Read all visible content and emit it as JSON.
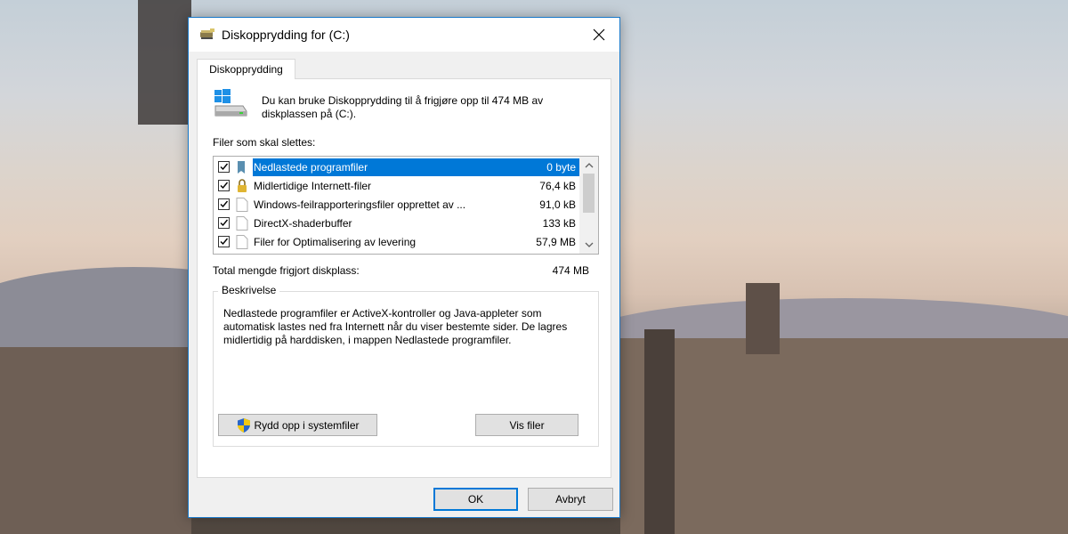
{
  "window": {
    "title": "Diskopprydding for  (C:)",
    "close_glyph": "✕"
  },
  "tab": {
    "label": "Diskopprydding"
  },
  "intro_text": "Du kan bruke Diskopprydding til å frigjøre opp til 474 MB av diskplassen på  (C:).",
  "files_label": "Filer som skal slettes:",
  "files": [
    {
      "label": "Nedlastede programfiler",
      "size": "0 byte",
      "checked": true,
      "selected": true,
      "icon": "folder-icon"
    },
    {
      "label": "Midlertidige Internett-filer",
      "size": "76,4 kB",
      "checked": true,
      "selected": false,
      "icon": "lock-icon"
    },
    {
      "label": "Windows-feilrapporteringsfiler opprettet av ...",
      "size": "91,0 kB",
      "checked": true,
      "selected": false,
      "icon": "file-icon"
    },
    {
      "label": "DirectX-shaderbuffer",
      "size": "133 kB",
      "checked": true,
      "selected": false,
      "icon": "file-icon"
    },
    {
      "label": "Filer for Optimalisering av levering",
      "size": "57,9 MB",
      "checked": true,
      "selected": false,
      "icon": "file-icon"
    }
  ],
  "total": {
    "label": "Total mengde frigjort diskplass:",
    "value": "474 MB"
  },
  "description": {
    "title": "Beskrivelse",
    "text": "Nedlastede programfiler er ActiveX-kontroller og Java-appleter som automatisk lastes ned fra Internett når du viser bestemte sider. De lagres midlertidig på harddisken, i mappen Nedlastede programfiler."
  },
  "buttons": {
    "system_files": "Rydd opp i systemfiler",
    "view_files": "Vis filer",
    "ok": "OK",
    "cancel": "Avbryt"
  },
  "colors": {
    "selection": "#0078d7",
    "dialog_border": "#1979ca"
  }
}
